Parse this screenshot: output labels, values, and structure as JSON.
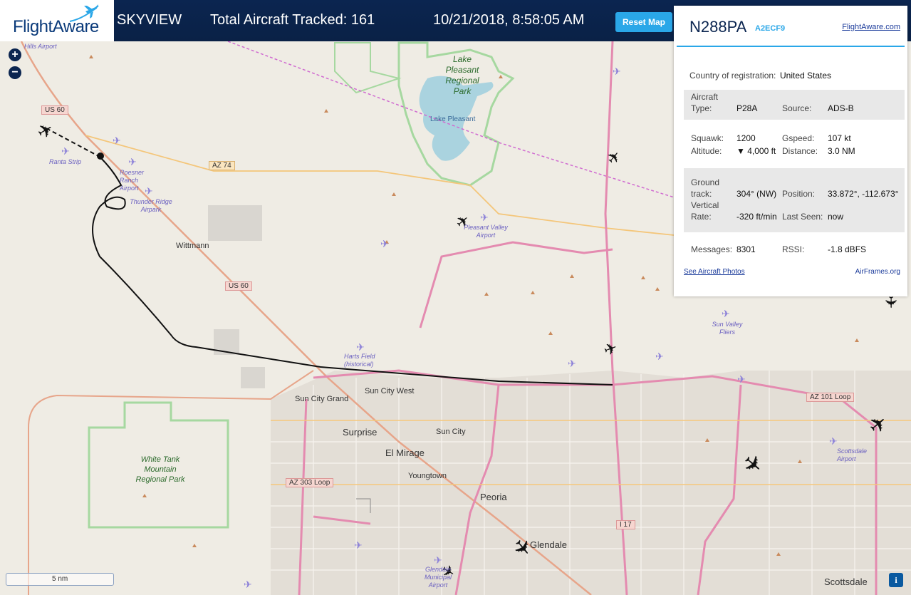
{
  "topbar": {
    "logo": "FlightAware",
    "title": "SKYVIEW",
    "tracked": "Total Aircraft Tracked: 161",
    "datetime": "10/21/2018, 8:58:05 AM",
    "reset_label": "Reset Map"
  },
  "map": {
    "zoom_in": "+",
    "zoom_out": "−",
    "scale_label": "5 nm",
    "info_label": "i",
    "places": [
      "Lake Pleasant Regional Park",
      "Lake Pleasant",
      "Wittmann",
      "Sun City Grand",
      "Sun City West",
      "Surprise",
      "El Mirage",
      "Sun City",
      "Youngtown",
      "Peoria",
      "Glendale",
      "Scottsdale",
      "White Tank Mountain Regional Park"
    ],
    "airports": [
      "Hills Airport",
      "Ranta Strip",
      "Roesner Ranch Airport",
      "Thunder Ridge Airpark",
      "Pleasant Valley Airport",
      "Harts Field (historical)",
      "Sun Valley Fliers",
      "Scottsdale Airport",
      "Glendale Municipal Airport"
    ],
    "roads": [
      "US 60",
      "AZ 74",
      "AZ 101 Loop",
      "AZ 303 Loop",
      "I 17"
    ]
  },
  "panel": {
    "ident": "N288PA",
    "hex": "A2ECF9",
    "fa_link": "FlightAware.com",
    "country_label": "Country of registration:",
    "country_value": "United States",
    "type_label": "Aircraft Type:",
    "type_value": "P28A",
    "source_label": "Source:",
    "source_value": "ADS-B",
    "squawk_label": "Squawk:",
    "squawk_value": "1200",
    "gspeed_label": "Gspeed:",
    "gspeed_value": "107 kt",
    "altitude_label": "Altitude:",
    "altitude_value": "▼ 4,000 ft",
    "distance_label": "Distance:",
    "distance_value": "3.0 NM",
    "track_label": "Ground track:",
    "track_value": "304° (NW)",
    "position_label": "Position:",
    "position_value": "33.872°, -112.673°",
    "vrate_label": "Vertical Rate:",
    "vrate_value": "-320 ft/min",
    "lastseen_label": "Last Seen:",
    "lastseen_value": "now",
    "messages_label": "Messages:",
    "messages_value": "8301",
    "rssi_label": "RSSI:",
    "rssi_value": "-1.8 dBFS",
    "photos_link": "See Aircraft Photos",
    "airframes_link": "AirFrames.org"
  }
}
